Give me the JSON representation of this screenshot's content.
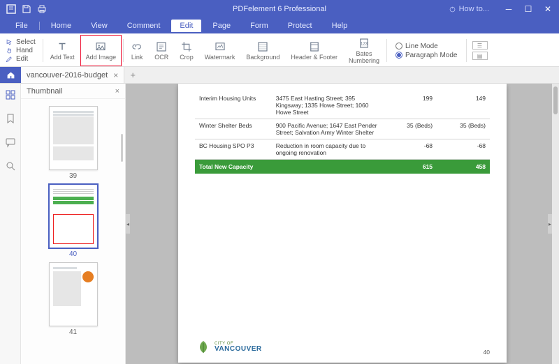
{
  "titlebar": {
    "app_name": "PDFelement 6 Professional",
    "howto": "How to..."
  },
  "menu": {
    "items": [
      "File",
      "Home",
      "View",
      "Comment",
      "Edit",
      "Page",
      "Form",
      "Protect",
      "Help"
    ],
    "active_index": 4
  },
  "ribbon": {
    "left_actions": {
      "select": "Select",
      "hand": "Hand",
      "edit": "Edit"
    },
    "tools": {
      "add_text": "Add Text",
      "add_image": "Add Image",
      "link": "Link",
      "ocr": "OCR",
      "crop": "Crop",
      "watermark": "Watermark",
      "background": "Background",
      "header_footer": "Header & Footer",
      "bates": "Bates\nNumbering"
    },
    "modes": {
      "line": "Line Mode",
      "paragraph": "Paragraph Mode",
      "selected": "paragraph"
    }
  },
  "tabs": {
    "doc_name": "vancouver-2016-budget"
  },
  "thumb": {
    "title": "Thumbnail",
    "pages": [
      {
        "num": "39",
        "selected": false
      },
      {
        "num": "40",
        "selected": true
      },
      {
        "num": "41",
        "selected": false
      }
    ]
  },
  "page": {
    "rows": [
      {
        "name": "Interim Housing Units",
        "desc": "3475 East Hasting Street; 395 Kingsway; 1335 Howe Street; 1060 Howe Street",
        "v1": "199",
        "v2": "149"
      },
      {
        "name": "Winter Shelter Beds",
        "desc": "900 Pacific Avenue; 1647 East Pender Street; Salvation Army Winter Shelter",
        "v1": "35 (Beds)",
        "v2": "35 (Beds)"
      },
      {
        "name": "BC Housing SPO P3",
        "desc": "Reduction in room capacity due to ongoing renovation",
        "v1": "-68",
        "v2": "-68"
      }
    ],
    "total": {
      "label": "Total New Capacity",
      "v1": "615",
      "v2": "458"
    },
    "footer": {
      "city_of": "CITY OF",
      "vancouver": "VANCOUVER",
      "page_num": "40"
    }
  }
}
